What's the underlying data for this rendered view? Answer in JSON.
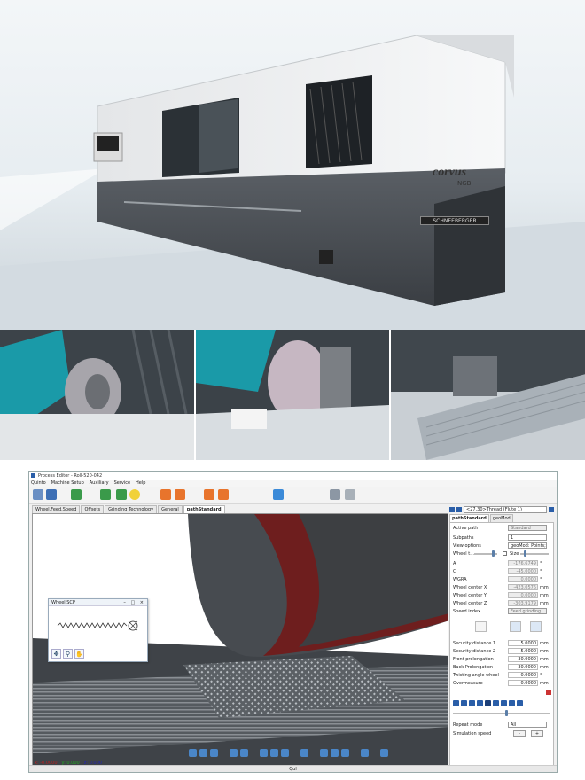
{
  "machine": {
    "brand": "corvus",
    "model": "NGB",
    "manufacturer": "SCHNEEBERGER"
  },
  "window": {
    "title": "Process Editor - Roll-520-042"
  },
  "menu": [
    "Quinto",
    "Machine Setup",
    "Auxiliary",
    "Service",
    "Help"
  ],
  "tabs": [
    "Wheel,Feed,Speed",
    "Offsets",
    "Grinding Technology",
    "General",
    "pathStandard"
  ],
  "active_tab": "pathStandard",
  "scp_window": {
    "title": "Wheel SCP"
  },
  "coords": {
    "x": "x: -0.0000",
    "y": "y: 0.000",
    "z": "z: 0.000"
  },
  "status_text": "Qul",
  "panel": {
    "path_dropdown": "<27,30>Thread (Flute 1)",
    "tabs": [
      "pathStandard",
      "geoMod"
    ],
    "active_path_label": "Active path",
    "active_path_value": "Standard",
    "subpaths_label": "Subpaths",
    "subpaths_value": "1",
    "view_options_label": "View options",
    "view_options_value": "geoMod: Points; Wheel ...",
    "wheel_label": "Wheel t...",
    "size_label": "Size",
    "params": [
      {
        "label": "A",
        "value": "-176.6749",
        "unit": "°"
      },
      {
        "label": "C",
        "value": "-45.0000",
        "unit": "°"
      },
      {
        "label": "WGRA",
        "value": "0.0000",
        "unit": "°"
      },
      {
        "label": "Wheel center X",
        "value": "-423.0576",
        "unit": "mm"
      },
      {
        "label": "Wheel center Y",
        "value": "0.0000",
        "unit": "mm"
      },
      {
        "label": "Wheel center Z",
        "value": "-303.9179",
        "unit": "mm"
      }
    ],
    "speed_index_label": "Speed index",
    "speed_index_value": "Feed grinding",
    "distances": [
      {
        "label": "Security distance 1",
        "value": "5.0000",
        "unit": "mm"
      },
      {
        "label": "Security distance 2",
        "value": "5.0000",
        "unit": "mm"
      },
      {
        "label": "Front prolongation",
        "value": "30.0000",
        "unit": "mm"
      },
      {
        "label": "Back Prolongation",
        "value": "30.0000",
        "unit": "mm"
      },
      {
        "label": "Twisting angle wheel",
        "value": "0.0000",
        "unit": "°"
      },
      {
        "label": "Overmeasure",
        "value": "0.0000",
        "unit": "mm"
      }
    ],
    "repeat_mode_label": "Repeat mode",
    "repeat_mode_value": "All",
    "sim_speed_label": "Simulation speed",
    "minus": "-",
    "plus": "+"
  }
}
